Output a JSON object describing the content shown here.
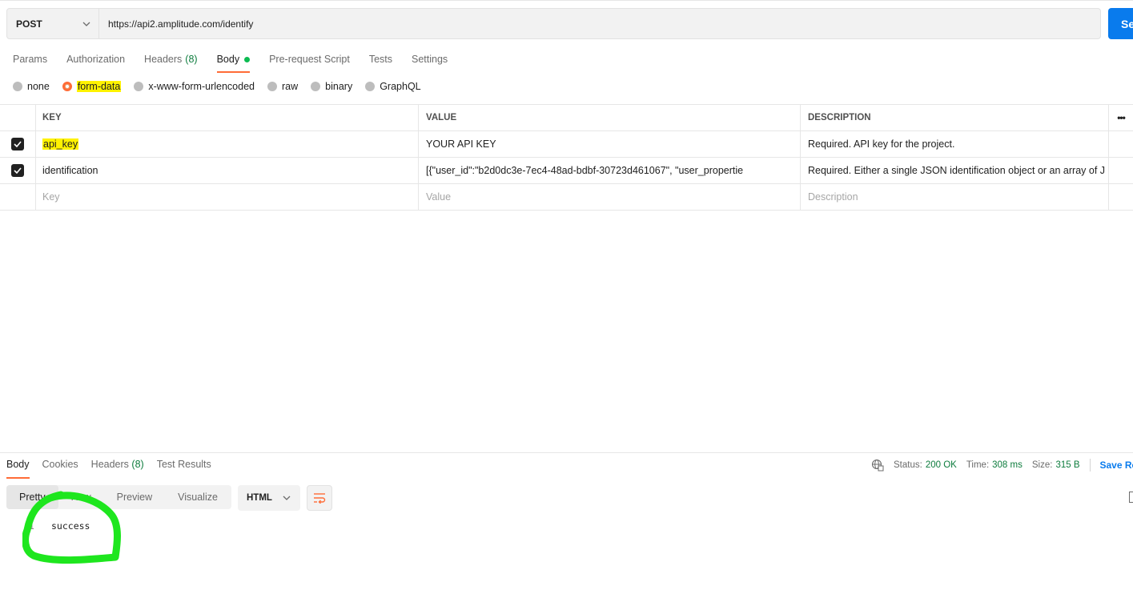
{
  "request": {
    "method": "POST",
    "url": "https://api2.amplitude.com/identify",
    "send_label": "Se"
  },
  "request_tabs": [
    {
      "label": "Params",
      "count": ""
    },
    {
      "label": "Authorization",
      "count": ""
    },
    {
      "label": "Headers",
      "count": "(8)"
    },
    {
      "label": "Body",
      "count": ""
    },
    {
      "label": "Pre-request Script",
      "count": ""
    },
    {
      "label": "Tests",
      "count": ""
    },
    {
      "label": "Settings",
      "count": ""
    }
  ],
  "body_types": [
    "none",
    "form-data",
    "x-www-form-urlencoded",
    "raw",
    "binary",
    "GraphQL"
  ],
  "table": {
    "headers": [
      "KEY",
      "VALUE",
      "DESCRIPTION"
    ],
    "rows": [
      {
        "key": "api_key",
        "value": "YOUR API KEY",
        "description": "Required. API key for the project."
      },
      {
        "key": "identification",
        "value": "[{\"user_id\":\"b2d0dc3e-7ec4-48ad-bdbf-30723d461067\", \"user_propertie",
        "description": "Required. Either a single JSON identification object or an array of J"
      }
    ],
    "placeholder": {
      "key": "Key",
      "value": "Value",
      "description": "Description"
    }
  },
  "response": {
    "tabs": [
      {
        "label": "Body",
        "count": ""
      },
      {
        "label": "Cookies",
        "count": ""
      },
      {
        "label": "Headers",
        "count": "(8)"
      },
      {
        "label": "Test Results",
        "count": ""
      }
    ],
    "status_label": "Status:",
    "status_value": "200 OK",
    "time_label": "Time:",
    "time_value": "308 ms",
    "size_label": "Size:",
    "size_value": "315 B",
    "save_label": "Save Re",
    "views": [
      "Pretty",
      "Raw",
      "Preview",
      "Visualize"
    ],
    "format": "HTML",
    "line_number": "1",
    "line_text": "success"
  },
  "colors": {
    "accent": "#ff6c37",
    "send": "#097bed",
    "status_ok": "#0d7c3d",
    "highlight": "#fff200",
    "annotation": "#1ee61e"
  }
}
